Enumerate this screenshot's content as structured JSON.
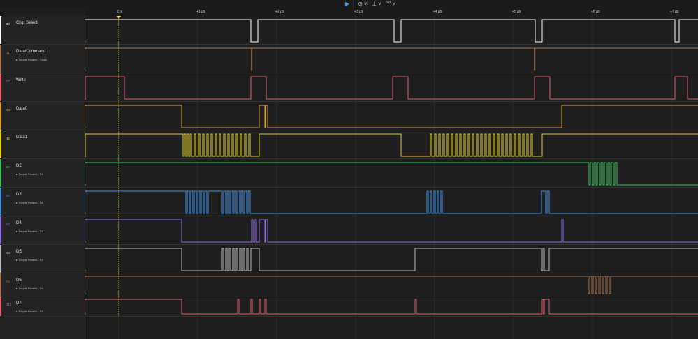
{
  "toolbar": {
    "play_icon": "▶",
    "opt1_icon": "⊙ ˅",
    "opt2_icon": "⊥ ˅",
    "opt3_icon": "♈ ˅"
  },
  "timeline": {
    "ticks": [
      "0 s",
      "+1 µs",
      "+2 µs",
      "+3 µs",
      "+4 µs",
      "+5 µs",
      "+6 µs",
      "+7 µs"
    ]
  },
  "colors": [
    "#ffffff",
    "#a0785a",
    "#e06070",
    "#e0a030",
    "#e0d030",
    "#40c060",
    "#4090e0",
    "#9070e0",
    "#bbbbbb",
    "#a07050",
    "#e06070"
  ],
  "channels": [
    {
      "id": "D0",
      "name": "Chip Select",
      "sub": "",
      "edges": [
        0,
        238,
        248,
        443,
        453,
        645,
        655,
        845,
        851
      ]
    },
    {
      "id": "D1",
      "name": "Data/Command",
      "sub": "Simple Parallel - Clock",
      "edges": [
        0,
        238.8,
        239.6,
        643.8,
        644.6
      ]
    },
    {
      "id": "D2",
      "name": "Write",
      "sub": "",
      "edges": [
        1,
        57,
        238,
        260,
        441,
        463,
        644,
        666,
        845,
        863
      ]
    },
    {
      "id": "D3",
      "name": "Data0",
      "sub": "",
      "edges": [
        0,
        139,
        250,
        258,
        259,
        262,
        683
      ]
    },
    {
      "id": "D4",
      "name": "Data1",
      "sub": "",
      "edges": [
        1,
        141,
        143,
        145,
        147,
        149,
        151,
        153,
        157,
        159,
        163,
        165,
        169,
        171,
        175,
        177,
        181,
        183,
        187,
        189,
        193,
        195,
        199,
        201,
        205,
        207,
        211,
        213,
        217,
        219,
        223,
        225,
        229,
        231,
        235,
        237,
        250,
        453,
        495,
        497,
        501,
        503,
        507,
        509,
        513,
        515,
        519,
        521,
        525,
        527,
        531,
        533,
        537,
        539,
        543,
        545,
        549,
        551,
        555,
        557,
        561,
        563,
        567,
        569,
        573,
        575,
        579,
        581,
        585,
        587,
        591,
        593,
        597,
        599,
        603,
        605,
        609,
        611,
        615,
        617,
        621,
        623,
        627,
        629,
        633,
        635,
        639,
        641,
        655
      ]
    },
    {
      "id": "D5",
      "name": "D2",
      "sub": "Simple Parallel - D0",
      "edges": [
        0,
        722,
        724,
        727,
        729,
        732,
        734,
        737,
        739,
        742,
        744,
        747,
        749,
        752,
        754,
        757,
        759,
        762
      ]
    },
    {
      "id": "D6",
      "name": "D3",
      "sub": "Simple Parallel - D1",
      "edges": [
        0,
        145,
        147,
        150,
        152,
        155,
        157,
        160,
        162,
        165,
        167,
        170,
        172,
        175,
        177,
        197,
        199,
        202,
        204,
        207,
        209,
        212,
        214,
        217,
        219,
        222,
        224,
        227,
        229,
        232,
        234,
        237,
        490,
        492,
        495,
        497,
        500,
        502,
        505,
        507,
        510,
        512,
        654,
        660,
        662,
        665
      ]
    },
    {
      "id": "D7",
      "name": "D4",
      "sub": "Simple Parallel - D2",
      "edges": [
        0,
        139,
        239,
        241,
        244,
        246,
        250,
        258,
        259,
        262,
        683,
        685
      ]
    },
    {
      "id": "D8",
      "name": "D5",
      "sub": "Simple Parallel - D3",
      "edges": [
        0,
        139,
        197,
        199,
        202,
        204,
        207,
        209,
        212,
        214,
        217,
        219,
        222,
        224,
        227,
        229,
        232,
        234,
        238,
        250,
        473,
        654,
        656,
        658,
        665
      ]
    },
    {
      "id": "D9",
      "name": "D6",
      "sub": "Simple Parallel - D4",
      "edges": [
        0,
        721,
        723,
        726,
        728,
        731,
        733,
        736,
        738,
        741,
        743,
        746,
        748,
        751,
        753
      ]
    },
    {
      "id": "D10",
      "name": "D7",
      "sub": "Simple Parallel - D5",
      "edges": [
        0,
        139,
        219,
        221,
        238,
        240,
        250,
        252,
        258,
        260,
        473,
        475,
        655,
        657,
        658,
        665
      ]
    }
  ]
}
